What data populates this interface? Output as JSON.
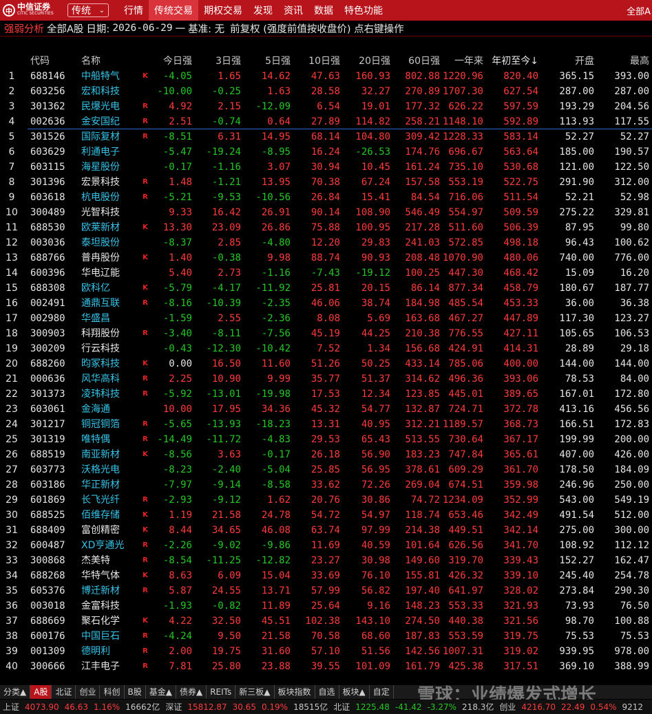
{
  "topbar": {
    "logo_cn": "中信证券",
    "logo_en": "CITIC SECURITIES",
    "mode": "传统",
    "nav": [
      "行情",
      "传统交易",
      "期权交易",
      "发现",
      "资讯",
      "数据",
      "特色功能"
    ],
    "nav_active": 1,
    "right": "全部A"
  },
  "infobar": {
    "title": "强弱分析",
    "market": "全部A股",
    "date_label": "日期:",
    "date": "2026-06-29",
    "dash": "一",
    "base": "基准: 无",
    "mode": "前复权 (强度前值按收盘价) 点右键操作"
  },
  "headers": [
    "代码",
    "名称",
    "今日强",
    "3日强",
    "5日强",
    "10日强",
    "20日强",
    "60日强",
    "一年来",
    "年初至今↓",
    "开盘",
    "最高"
  ],
  "colors": {
    "up": "#ff3b3b",
    "down": "#23c823",
    "name_yellow": "#ffff33",
    "name_cyan": "#35c3e8",
    "accent": "#b7141c"
  },
  "rows": [
    {
      "i": "1",
      "code": "688146",
      "name": "中船特气",
      "nc": "cyan",
      "f": "K",
      "v": [
        "-4.05",
        "1.65",
        "14.62",
        "47.63",
        "160.93",
        "802.88",
        "1220.96",
        "820.40",
        "365.15",
        "393.00"
      ]
    },
    {
      "i": "2",
      "code": "603256",
      "name": "宏和科技",
      "nc": "cyan",
      "f": "",
      "v": [
        "-10.00",
        "-0.25",
        "1.63",
        "28.58",
        "32.27",
        "270.89",
        "1707.30",
        "627.54",
        "287.00",
        "287.00"
      ]
    },
    {
      "i": "3",
      "code": "301362",
      "name": "民爆光电",
      "nc": "cyan",
      "f": "R",
      "v": [
        "4.92",
        "2.15",
        "-12.09",
        "6.54",
        "19.01",
        "177.32",
        "626.22",
        "597.59",
        "193.29",
        "204.56"
      ]
    },
    {
      "i": "4",
      "code": "002636",
      "name": "金安国纪",
      "nc": "cyan",
      "f": "R",
      "v": [
        "2.51",
        "-0.74",
        "0.64",
        "27.89",
        "114.82",
        "258.21",
        "1148.10",
        "592.89",
        "113.93",
        "117.55"
      ]
    },
    {
      "i": "5",
      "code": "301526",
      "name": "国际复材",
      "nc": "cyan",
      "f": "R",
      "v": [
        "-8.51",
        "6.31",
        "14.95",
        "68.14",
        "104.80",
        "309.42",
        "1228.33",
        "583.14",
        "52.27",
        "52.27"
      ]
    },
    {
      "i": "6",
      "code": "603629",
      "name": "利通电子",
      "nc": "cyan",
      "f": "",
      "v": [
        "-5.47",
        "-19.24",
        "-8.95",
        "16.24",
        "-26.53",
        "174.76",
        "696.67",
        "563.64",
        "185.00",
        "190.57"
      ]
    },
    {
      "i": "7",
      "code": "603115",
      "name": "海星股份",
      "nc": "cyan",
      "f": "",
      "v": [
        "-0.17",
        "-1.16",
        "3.07",
        "30.94",
        "10.45",
        "161.24",
        "735.10",
        "530.68",
        "121.00",
        "122.50"
      ]
    },
    {
      "i": "8",
      "code": "301396",
      "name": "宏景科技",
      "nc": "white",
      "f": "R",
      "v": [
        "1.48",
        "-1.21",
        "13.95",
        "70.38",
        "67.24",
        "157.58",
        "553.19",
        "522.75",
        "291.90",
        "312.00"
      ]
    },
    {
      "i": "9",
      "code": "603618",
      "name": "杭电股份",
      "nc": "cyan",
      "f": "R",
      "v": [
        "-5.21",
        "-9.53",
        "-10.56",
        "26.84",
        "15.41",
        "84.54",
        "716.06",
        "511.54",
        "52.21",
        "52.98"
      ]
    },
    {
      "i": "10",
      "code": "300489",
      "name": "光智科技",
      "nc": "white",
      "f": "",
      "v": [
        "9.33",
        "16.42",
        "26.91",
        "90.14",
        "108.90",
        "546.49",
        "554.97",
        "509.59",
        "275.22",
        "329.81"
      ]
    },
    {
      "i": "11",
      "code": "688530",
      "name": "欧莱新材",
      "nc": "cyan",
      "f": "K",
      "v": [
        "13.30",
        "23.09",
        "26.86",
        "75.88",
        "100.95",
        "217.28",
        "511.60",
        "506.39",
        "87.95",
        "99.80"
      ]
    },
    {
      "i": "12",
      "code": "003036",
      "name": "泰坦股份",
      "nc": "cyan",
      "f": "",
      "v": [
        "-8.37",
        "2.85",
        "-4.80",
        "12.20",
        "29.83",
        "241.03",
        "572.85",
        "498.18",
        "96.43",
        "100.62"
      ]
    },
    {
      "i": "13",
      "code": "688766",
      "name": "普冉股份",
      "nc": "white",
      "f": "K",
      "v": [
        "1.40",
        "-0.38",
        "9.98",
        "88.74",
        "90.93",
        "208.48",
        "1070.90",
        "480.06",
        "740.00",
        "776.00"
      ]
    },
    {
      "i": "14",
      "code": "600396",
      "name": "华电辽能",
      "nc": "white",
      "f": "",
      "v": [
        "5.40",
        "2.73",
        "-1.16",
        "-7.43",
        "-19.12",
        "100.25",
        "447.30",
        "468.42",
        "15.09",
        "16.20"
      ]
    },
    {
      "i": "15",
      "code": "688308",
      "name": "欧科亿",
      "nc": "cyan",
      "f": "K",
      "v": [
        "-5.79",
        "-4.17",
        "-11.92",
        "25.81",
        "20.15",
        "86.14",
        "877.34",
        "458.79",
        "180.67",
        "187.77"
      ]
    },
    {
      "i": "16",
      "code": "002491",
      "name": "通鼎互联",
      "nc": "cyan",
      "f": "R",
      "v": [
        "-8.16",
        "-10.39",
        "-2.35",
        "46.06",
        "38.74",
        "184.98",
        "485.54",
        "453.33",
        "36.00",
        "36.38"
      ]
    },
    {
      "i": "17",
      "code": "002980",
      "name": "华盛昌",
      "nc": "cyan",
      "f": "",
      "v": [
        "-1.59",
        "2.55",
        "-2.36",
        "8.08",
        "5.69",
        "163.68",
        "467.27",
        "447.89",
        "117.30",
        "123.27"
      ]
    },
    {
      "i": "18",
      "code": "300903",
      "name": "科翔股份",
      "nc": "white",
      "f": "R",
      "v": [
        "-3.40",
        "-8.11",
        "-7.56",
        "45.19",
        "44.25",
        "210.38",
        "776.55",
        "427.11",
        "105.65",
        "106.53"
      ]
    },
    {
      "i": "19",
      "code": "300209",
      "name": "行云科技",
      "nc": "white",
      "f": "",
      "v": [
        "-0.43",
        "-12.30",
        "-10.42",
        "7.52",
        "1.34",
        "156.68",
        "424.91",
        "414.31",
        "28.89",
        "29.18"
      ]
    },
    {
      "i": "20",
      "code": "688260",
      "name": "昀冢科技",
      "nc": "cyan",
      "f": "K",
      "v": [
        "0.00",
        "16.50",
        "11.60",
        "51.26",
        "50.25",
        "433.14",
        "785.06",
        "400.00",
        "144.00",
        "144.00"
      ]
    },
    {
      "i": "21",
      "code": "000636",
      "name": "风华高科",
      "nc": "cyan",
      "f": "R",
      "v": [
        "2.25",
        "10.90",
        "9.99",
        "35.77",
        "51.37",
        "314.62",
        "496.36",
        "393.06",
        "78.53",
        "84.00"
      ]
    },
    {
      "i": "22",
      "code": "301373",
      "name": "凌玮科技",
      "nc": "cyan",
      "f": "R",
      "v": [
        "-5.92",
        "-13.01",
        "-19.98",
        "17.53",
        "12.34",
        "123.85",
        "445.01",
        "389.65",
        "167.01",
        "172.80"
      ]
    },
    {
      "i": "23",
      "code": "603061",
      "name": "金海通",
      "nc": "cyan",
      "f": "",
      "v": [
        "10.00",
        "17.95",
        "34.36",
        "45.32",
        "54.77",
        "132.87",
        "724.71",
        "372.78",
        "413.16",
        "456.56"
      ]
    },
    {
      "i": "24",
      "code": "301217",
      "name": "铜冠铜箔",
      "nc": "cyan",
      "f": "R",
      "v": [
        "-5.65",
        "-13.93",
        "-18.23",
        "13.31",
        "40.95",
        "312.21",
        "1189.57",
        "368.73",
        "166.51",
        "172.83"
      ]
    },
    {
      "i": "25",
      "code": "301319",
      "name": "唯特偶",
      "nc": "cyan",
      "f": "R",
      "v": [
        "-14.49",
        "-11.72",
        "-4.83",
        "29.53",
        "65.43",
        "513.55",
        "730.64",
        "367.17",
        "199.99",
        "200.00"
      ]
    },
    {
      "i": "26",
      "code": "688519",
      "name": "南亚新材",
      "nc": "cyan",
      "f": "K",
      "v": [
        "-8.56",
        "3.63",
        "-0.17",
        "26.18",
        "56.90",
        "183.23",
        "747.84",
        "365.61",
        "407.00",
        "426.00"
      ]
    },
    {
      "i": "27",
      "code": "603773",
      "name": "沃格光电",
      "nc": "cyan",
      "f": "",
      "v": [
        "-8.23",
        "-2.40",
        "-5.04",
        "25.85",
        "56.95",
        "378.61",
        "609.29",
        "361.70",
        "178.50",
        "184.09"
      ]
    },
    {
      "i": "28",
      "code": "603186",
      "name": "华正新材",
      "nc": "cyan",
      "f": "",
      "v": [
        "-7.97",
        "-9.14",
        "-8.58",
        "33.62",
        "72.26",
        "269.04",
        "674.51",
        "359.98",
        "246.96",
        "250.00"
      ]
    },
    {
      "i": "29",
      "code": "601869",
      "name": "长飞光纤",
      "nc": "cyan",
      "f": "R",
      "v": [
        "-2.93",
        "-9.12",
        "1.62",
        "20.76",
        "30.86",
        "74.72",
        "1234.09",
        "352.99",
        "543.00",
        "549.19"
      ]
    },
    {
      "i": "30",
      "code": "688525",
      "name": "佰维存储",
      "nc": "cyan",
      "f": "K",
      "v": [
        "1.19",
        "21.58",
        "24.78",
        "54.72",
        "54.97",
        "118.74",
        "653.46",
        "342.49",
        "491.54",
        "512.00"
      ]
    },
    {
      "i": "31",
      "code": "688409",
      "name": "富创精密",
      "nc": "white",
      "f": "K",
      "v": [
        "8.44",
        "34.65",
        "46.08",
        "63.74",
        "97.99",
        "214.38",
        "449.51",
        "342.14",
        "275.00",
        "300.00"
      ]
    },
    {
      "i": "32",
      "code": "600487",
      "name": "XD亨通光",
      "nc": "cyan",
      "f": "R",
      "v": [
        "-2.26",
        "-9.02",
        "-9.86",
        "11.69",
        "40.59",
        "101.64",
        "626.56",
        "341.70",
        "108.92",
        "112.12"
      ]
    },
    {
      "i": "33",
      "code": "300868",
      "name": "杰美特",
      "nc": "white",
      "f": "R",
      "v": [
        "-8.54",
        "-11.25",
        "-12.82",
        "23.27",
        "30.98",
        "149.60",
        "319.70",
        "339.43",
        "152.27",
        "162.47"
      ]
    },
    {
      "i": "34",
      "code": "688268",
      "name": "华特气体",
      "nc": "white",
      "f": "K",
      "v": [
        "8.63",
        "6.09",
        "15.04",
        "33.69",
        "76.10",
        "155.81",
        "426.32",
        "339.10",
        "245.40",
        "254.78"
      ]
    },
    {
      "i": "35",
      "code": "605376",
      "name": "博迁新材",
      "nc": "cyan",
      "f": "R",
      "v": [
        "5.87",
        "24.55",
        "13.71",
        "57.99",
        "56.82",
        "197.40",
        "641.97",
        "328.02",
        "273.84",
        "290.30"
      ]
    },
    {
      "i": "36",
      "code": "003018",
      "name": "金富科技",
      "nc": "white",
      "f": "",
      "v": [
        "-1.93",
        "-0.82",
        "11.89",
        "25.64",
        "9.16",
        "148.23",
        "553.33",
        "321.93",
        "73.93",
        "76.50"
      ]
    },
    {
      "i": "37",
      "code": "688669",
      "name": "聚石化学",
      "nc": "white",
      "f": "K",
      "v": [
        "4.22",
        "32.50",
        "45.51",
        "102.38",
        "143.10",
        "274.50",
        "440.38",
        "321.56",
        "98.70",
        "100.88"
      ]
    },
    {
      "i": "38",
      "code": "600176",
      "name": "中国巨石",
      "nc": "cyan",
      "f": "R",
      "v": [
        "-4.24",
        "9.50",
        "21.58",
        "70.58",
        "68.60",
        "187.83",
        "553.59",
        "319.75",
        "75.53",
        "75.53"
      ]
    },
    {
      "i": "39",
      "code": "001309",
      "name": "德明利",
      "nc": "cyan",
      "f": "R",
      "v": [
        "2.00",
        "19.75",
        "31.60",
        "57.10",
        "51.56",
        "142.56",
        "1007.31",
        "319.02",
        "939.95",
        "978.00"
      ]
    },
    {
      "i": "40",
      "code": "300666",
      "name": "江丰电子",
      "nc": "white",
      "f": "R",
      "v": [
        "7.81",
        "25.80",
        "23.88",
        "39.55",
        "101.09",
        "161.79",
        "425.38",
        "317.51",
        "369.10",
        "388.99"
      ]
    }
  ],
  "tabs": [
    "分类▲",
    "A股",
    "北证",
    "创业",
    "科创",
    "B股",
    "基金▲",
    "债券▲",
    "REITs",
    "新三板▲",
    "板块指数",
    "自选",
    "板块▲",
    "自定"
  ],
  "tabs_active": 1,
  "watermark": "雪球：业绩爆发式增长",
  "status": {
    "sh_label": "上证",
    "sh_val": "4073.90",
    "sh_chg": "46.63",
    "sh_pct": "1.16%",
    "sh_amt": "16662亿",
    "sz_label": "深证",
    "sz_val": "15812.87",
    "sz_chg": "30.65",
    "sz_pct": "0.19%",
    "sz_amt": "18515亿",
    "bz_label": "北证",
    "bz_val": "1225.48",
    "bz_chg": "-41.42",
    "bz_pct": "-3.27%",
    "bz_amt": "218.3亿",
    "cy_label": "创业",
    "cy_val": "4216.70",
    "cy_chg": "22.49",
    "cy_pct": "0.54%",
    "cy_amt": "9212"
  }
}
